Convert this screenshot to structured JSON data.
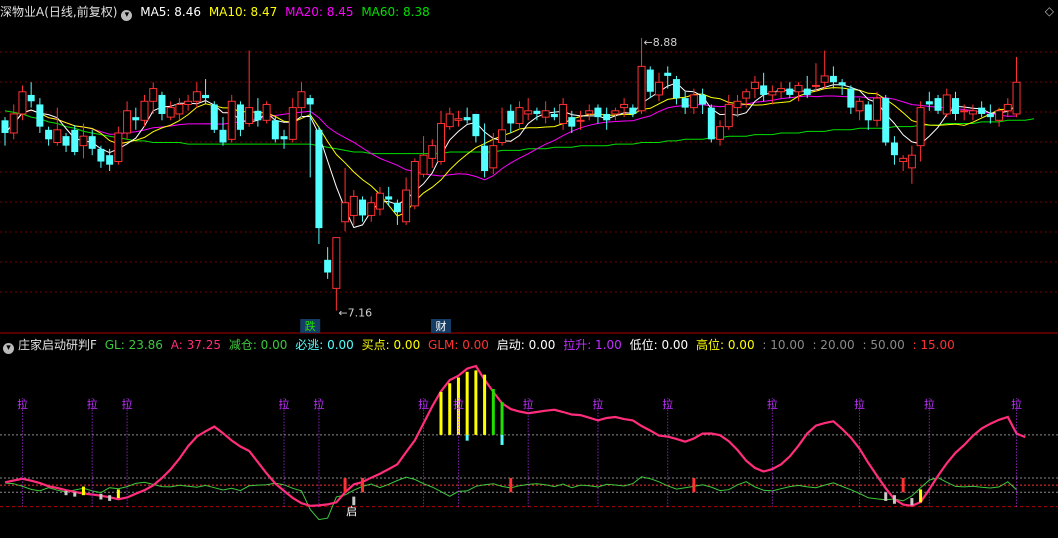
{
  "header": {
    "title": "深物业A(日线,前复权)",
    "ma5": "MA5: 8.46",
    "ma10": "MA10: 8.47",
    "ma20": "MA20: 8.45",
    "ma60": "MA60: 8.38",
    "corner": "◇"
  },
  "indicator_header": {
    "title": "庄家启动研判F",
    "gl": "GL: 23.86",
    "a": "A: 37.25",
    "jc": "减仓: 0.00",
    "bt": "必逃: 0.00",
    "md": "买点: 0.00",
    "glm": "GLM: 0.00",
    "qd": "启动: 0.00",
    "ls": "拉升: 1.00",
    "dw": "低位: 0.00",
    "gw": "高位: 0.00",
    "l10": ": 10.00",
    "l20": ": 20.00",
    "l50": ": 50.00",
    "l15": ": 15.00"
  },
  "colors": {
    "up": "#ff3232",
    "down": "#54ffff",
    "ma5": "#ffffff",
    "ma10": "#ffff00",
    "ma20": "#ff00ff",
    "ma60": "#00e000",
    "pink": "#ff2d7a",
    "green": "#3ec83e",
    "purple": "#c030ff",
    "grid": "#7a0000"
  },
  "chart_data": [
    {
      "type": "candlestick",
      "ylim": [
        7.05,
        8.98
      ],
      "high_label": "8.88",
      "low_label": "7.16",
      "markers": [
        {
          "index": 35,
          "text": "跌"
        },
        {
          "index": 50,
          "text": "财"
        }
      ],
      "ohlc": [
        [
          8.36,
          8.38,
          8.2,
          8.28
        ],
        [
          8.28,
          8.46,
          8.24,
          8.4
        ],
        [
          8.4,
          8.58,
          8.36,
          8.54
        ],
        [
          8.52,
          8.6,
          8.44,
          8.48
        ],
        [
          8.46,
          8.5,
          8.28,
          8.32
        ],
        [
          8.3,
          8.32,
          8.2,
          8.24
        ],
        [
          8.22,
          8.44,
          8.2,
          8.3
        ],
        [
          8.26,
          8.28,
          8.16,
          8.2
        ],
        [
          8.3,
          8.33,
          8.14,
          8.16
        ],
        [
          8.2,
          8.34,
          8.12,
          8.26
        ],
        [
          8.26,
          8.3,
          8.14,
          8.18
        ],
        [
          8.18,
          8.2,
          8.06,
          8.1
        ],
        [
          8.14,
          8.18,
          8.04,
          8.08
        ],
        [
          8.1,
          8.32,
          8.08,
          8.28
        ],
        [
          8.28,
          8.48,
          8.24,
          8.42
        ],
        [
          8.38,
          8.44,
          8.3,
          8.36
        ],
        [
          8.36,
          8.52,
          8.32,
          8.48
        ],
        [
          8.48,
          8.6,
          8.4,
          8.56
        ],
        [
          8.52,
          8.54,
          8.36,
          8.4
        ],
        [
          8.38,
          8.48,
          8.36,
          8.44
        ],
        [
          8.4,
          8.5,
          8.36,
          8.46
        ],
        [
          8.46,
          8.52,
          8.42,
          8.48
        ],
        [
          8.48,
          8.6,
          8.44,
          8.54
        ],
        [
          8.52,
          8.62,
          8.46,
          8.5
        ],
        [
          8.46,
          8.48,
          8.28,
          8.3
        ],
        [
          8.3,
          8.38,
          8.2,
          8.22
        ],
        [
          8.24,
          8.52,
          8.22,
          8.48
        ],
        [
          8.46,
          8.48,
          8.26,
          8.3
        ],
        [
          8.34,
          8.8,
          8.32,
          8.44
        ],
        [
          8.42,
          8.5,
          8.32,
          8.36
        ],
        [
          8.36,
          8.48,
          8.34,
          8.46
        ],
        [
          8.36,
          8.38,
          8.22,
          8.24
        ],
        [
          8.26,
          8.3,
          8.18,
          8.24
        ],
        [
          8.24,
          8.5,
          8.22,
          8.44
        ],
        [
          8.44,
          8.6,
          8.38,
          8.54
        ],
        [
          8.5,
          8.52,
          8.0,
          8.46
        ],
        [
          8.3,
          8.32,
          7.58,
          7.68
        ],
        [
          7.48,
          7.56,
          7.36,
          7.4
        ],
        [
          7.3,
          7.46,
          7.16,
          7.62
        ],
        [
          7.72,
          8.06,
          7.66,
          7.84
        ],
        [
          7.76,
          7.92,
          7.7,
          7.88
        ],
        [
          7.86,
          7.88,
          7.72,
          7.76
        ],
        [
          7.76,
          7.88,
          7.72,
          7.84
        ],
        [
          7.8,
          7.94,
          7.76,
          7.9
        ],
        [
          7.88,
          7.94,
          7.82,
          7.86
        ],
        [
          7.84,
          7.86,
          7.7,
          7.78
        ],
        [
          7.72,
          8.0,
          7.7,
          7.92
        ],
        [
          7.82,
          8.12,
          7.8,
          8.1
        ],
        [
          8.02,
          8.26,
          8.0,
          8.14
        ],
        [
          8.12,
          8.24,
          8.06,
          8.2
        ],
        [
          8.1,
          8.42,
          8.08,
          8.34
        ],
        [
          8.32,
          8.44,
          8.3,
          8.4
        ],
        [
          8.36,
          8.42,
          8.32,
          8.37
        ],
        [
          8.38,
          8.44,
          8.34,
          8.36
        ],
        [
          8.4,
          8.4,
          8.22,
          8.26
        ],
        [
          8.2,
          8.34,
          8.0,
          8.04
        ],
        [
          8.06,
          8.28,
          8.02,
          8.2
        ],
        [
          8.22,
          8.44,
          8.2,
          8.3
        ],
        [
          8.42,
          8.46,
          8.28,
          8.34
        ],
        [
          8.34,
          8.48,
          8.3,
          8.44
        ],
        [
          8.4,
          8.5,
          8.36,
          8.42
        ],
        [
          8.42,
          8.44,
          8.36,
          8.4
        ],
        [
          8.38,
          8.48,
          8.34,
          8.42
        ],
        [
          8.4,
          8.44,
          8.36,
          8.38
        ],
        [
          8.34,
          8.5,
          8.3,
          8.46
        ],
        [
          8.38,
          8.42,
          8.28,
          8.32
        ],
        [
          8.36,
          8.42,
          8.3,
          8.36
        ],
        [
          8.4,
          8.46,
          8.36,
          8.42
        ],
        [
          8.44,
          8.46,
          8.34,
          8.38
        ],
        [
          8.4,
          8.44,
          8.3,
          8.36
        ],
        [
          8.4,
          8.44,
          8.36,
          8.42
        ],
        [
          8.44,
          8.5,
          8.38,
          8.46
        ],
        [
          8.44,
          8.46,
          8.38,
          8.4
        ],
        [
          8.42,
          8.88,
          8.4,
          8.7
        ],
        [
          8.68,
          8.7,
          8.5,
          8.54
        ],
        [
          8.52,
          8.66,
          8.48,
          8.6
        ],
        [
          8.66,
          8.7,
          8.56,
          8.64
        ],
        [
          8.62,
          8.64,
          8.46,
          8.5
        ],
        [
          8.5,
          8.54,
          8.4,
          8.44
        ],
        [
          8.44,
          8.56,
          8.4,
          8.52
        ],
        [
          8.52,
          8.56,
          8.4,
          8.46
        ],
        [
          8.44,
          8.46,
          8.22,
          8.24
        ],
        [
          8.24,
          8.36,
          8.2,
          8.32
        ],
        [
          8.32,
          8.52,
          8.3,
          8.46
        ],
        [
          8.44,
          8.52,
          8.38,
          8.48
        ],
        [
          8.5,
          8.56,
          8.44,
          8.54
        ],
        [
          8.56,
          8.64,
          8.5,
          8.6
        ],
        [
          8.58,
          8.66,
          8.48,
          8.52
        ],
        [
          8.52,
          8.58,
          8.46,
          8.54
        ],
        [
          8.54,
          8.6,
          8.5,
          8.56
        ],
        [
          8.56,
          8.6,
          8.5,
          8.52
        ],
        [
          8.54,
          8.6,
          8.48,
          8.58
        ],
        [
          8.56,
          8.64,
          8.5,
          8.52
        ],
        [
          8.58,
          8.72,
          8.54,
          8.58
        ],
        [
          8.6,
          8.8,
          8.56,
          8.64
        ],
        [
          8.64,
          8.7,
          8.56,
          8.6
        ],
        [
          8.6,
          8.62,
          8.52,
          8.58
        ],
        [
          8.56,
          8.58,
          8.4,
          8.44
        ],
        [
          8.42,
          8.5,
          8.36,
          8.48
        ],
        [
          8.46,
          8.48,
          8.3,
          8.36
        ],
        [
          8.36,
          8.54,
          8.32,
          8.5
        ],
        [
          8.5,
          8.52,
          8.2,
          8.22
        ],
        [
          8.22,
          8.26,
          8.08,
          8.14
        ],
        [
          8.1,
          8.14,
          8.04,
          8.12
        ],
        [
          8.06,
          8.2,
          7.96,
          8.14
        ],
        [
          8.2,
          8.48,
          8.1,
          8.44
        ],
        [
          8.48,
          8.54,
          8.42,
          8.46
        ],
        [
          8.5,
          8.52,
          8.4,
          8.42
        ],
        [
          8.4,
          8.56,
          8.38,
          8.52
        ],
        [
          8.5,
          8.54,
          8.36,
          8.4
        ],
        [
          8.42,
          8.46,
          8.36,
          8.42
        ],
        [
          8.4,
          8.46,
          8.36,
          8.42
        ],
        [
          8.44,
          8.48,
          8.38,
          8.4
        ],
        [
          8.4,
          8.46,
          8.34,
          8.38
        ],
        [
          8.36,
          8.44,
          8.32,
          8.42
        ],
        [
          8.42,
          8.5,
          8.38,
          8.46
        ],
        [
          8.4,
          8.76,
          8.38,
          8.6
        ]
      ],
      "ma60": [
        8.42,
        8.41,
        8.4,
        8.38,
        8.37,
        8.35,
        8.34,
        8.32,
        8.31,
        8.29,
        8.28,
        8.27,
        8.26,
        8.25,
        8.24,
        8.23,
        8.23,
        8.22,
        8.22,
        8.22,
        8.22,
        8.21,
        8.21,
        8.21,
        8.21,
        8.21,
        8.21,
        8.21,
        8.21,
        8.21,
        8.21,
        8.21,
        8.21,
        8.21,
        8.21,
        8.21,
        8.2,
        8.19,
        8.18,
        8.17,
        8.16,
        8.16,
        8.15,
        8.15,
        8.15,
        8.15,
        8.15,
        8.15,
        8.15,
        8.15,
        8.15,
        8.16,
        8.16,
        8.16,
        8.16,
        8.16,
        8.16,
        8.17,
        8.17,
        8.17,
        8.18,
        8.18,
        8.18,
        8.19,
        8.19,
        8.19,
        8.2,
        8.2,
        8.2,
        8.2,
        8.21,
        8.21,
        8.21,
        8.22,
        8.22,
        8.22,
        8.23,
        8.23,
        8.24,
        8.24,
        8.24,
        8.25,
        8.25,
        8.26,
        8.26,
        8.26,
        8.27,
        8.27,
        8.27,
        8.28,
        8.28,
        8.28,
        8.29,
        8.29,
        8.29,
        8.3,
        8.3,
        8.3,
        8.31,
        8.31,
        8.31,
        8.31,
        8.32,
        8.32,
        8.32,
        8.33,
        8.33,
        8.33,
        8.34,
        8.34,
        8.34,
        8.34,
        8.35,
        8.35,
        8.35,
        8.36,
        8.36,
        8.36,
        8.37
      ]
    },
    {
      "type": "line",
      "title": "庄家启动研判F",
      "ylim": [
        -10,
        105
      ],
      "ref_lines": [
        10,
        20,
        50,
        15
      ],
      "la_marks": [
        2,
        10,
        14,
        32,
        36,
        48,
        52,
        60,
        68,
        76,
        88,
        98,
        106,
        116
      ],
      "la_text": "拉",
      "qi_mark": {
        "index": 39,
        "text": "启"
      },
      "pink_series": [
        17.0,
        18.2,
        19.4,
        18.1,
        16.5,
        14.2,
        13.0,
        11.5,
        10.3,
        9.2,
        8.5,
        7.6,
        6.5,
        5.2,
        6.4,
        9.0,
        11.5,
        14.8,
        20.0,
        26.0,
        33.5,
        42.1,
        48.8,
        52.5,
        55.8,
        51.2,
        46.1,
        41.9,
        38.8,
        31.0,
        23.2,
        16.1,
        11.0,
        6.0,
        2.4,
        0.6,
        0.9,
        1.6,
        3.0,
        10.0,
        15.5,
        17.2,
        20.2,
        23.0,
        26.2,
        29.5,
        38.0,
        46.2,
        58.1,
        70.0,
        80.5,
        88.2,
        91.3,
        96.2,
        98.0,
        88.5,
        80.0,
        72.0,
        68.0,
        66.3,
        65.1,
        66.0,
        66.9,
        67.5,
        66.0,
        64.2,
        63.8,
        62.0,
        60.1,
        61.8,
        62.5,
        61.0,
        60.1,
        56.2,
        53.0,
        49.5,
        48.8,
        47.2,
        45.3,
        47.5,
        50.9,
        51.0,
        49.8,
        45.6,
        39.5,
        32.0,
        27.0,
        24.5,
        26.2,
        29.5,
        35.0,
        42.5,
        51.0,
        56.5,
        58.2,
        59.5,
        54.2,
        48.1,
        40.3,
        30.5,
        21.5,
        12.8,
        5.2,
        1.4,
        0.6,
        3.2,
        12.0,
        21.5,
        30.2,
        37.5,
        43.0,
        49.4,
        54.5,
        57.8,
        60.5,
        62.5,
        51.0,
        48.5
      ],
      "green_series": [
        16.5,
        16.0,
        14.2,
        12.0,
        11.0,
        13.2,
        11.5,
        10.2,
        11.6,
        12.8,
        11.0,
        9.8,
        13.2,
        12.5,
        14.0,
        16.2,
        17.0,
        15.5,
        14.0,
        13.8,
        14.9,
        14.2,
        13.5,
        14.8,
        13.2,
        11.6,
        12.8,
        11.2,
        14.5,
        15.0,
        15.2,
        16.4,
        15.2,
        12.8,
        11.0,
        -2.0,
        -9.0,
        -8.0,
        6.8,
        8.2,
        11.5,
        14.1,
        15.8,
        13.3,
        15.6,
        18.2,
        20.6,
        19.0,
        16.0,
        13.6,
        10.5,
        7.2,
        10.6,
        11.0,
        14.2,
        15.2,
        16.0,
        14.1,
        13.1,
        14.6,
        15.5,
        16.0,
        15.2,
        14.0,
        15.8,
        13.2,
        15.0,
        14.6,
        13.7,
        15.6,
        15.1,
        14.4,
        16.1,
        20.8,
        19.5,
        17.3,
        14.5,
        12.2,
        13.2,
        14.1,
        15.2,
        13.6,
        11.2,
        11.8,
        15.2,
        17.4,
        13.8,
        11.5,
        11.0,
        12.5,
        14.0,
        14.8,
        13.8,
        13.2,
        15.0,
        16.6,
        14.1,
        11.8,
        9.2,
        6.2,
        5.4,
        4.8,
        5.3,
        4.0,
        7.5,
        13.2,
        18.5,
        20.2,
        17.0,
        14.1,
        13.8,
        14.2,
        13.5,
        13.0,
        13.8,
        17.4,
        11.8
      ],
      "red_bars": [
        {
          "index": 39,
          "top": 20,
          "bottom": 10
        },
        {
          "index": 41,
          "top": 20,
          "bottom": 10
        },
        {
          "index": 58,
          "top": 20,
          "bottom": 10
        },
        {
          "index": 79,
          "top": 20,
          "bottom": 10
        },
        {
          "index": 103,
          "top": 20,
          "bottom": 10
        }
      ],
      "white_bars": [
        {
          "index": 7,
          "top": 11,
          "bottom": 8
        },
        {
          "index": 8,
          "top": 10,
          "bottom": 7
        },
        {
          "index": 11,
          "top": 9,
          "bottom": 5
        },
        {
          "index": 12,
          "top": 8,
          "bottom": 4
        },
        {
          "index": 40,
          "top": 7,
          "bottom": 1
        },
        {
          "index": 101,
          "top": 10,
          "bottom": 4
        },
        {
          "index": 102,
          "top": 8,
          "bottom": 2
        },
        {
          "index": 104,
          "top": 6,
          "bottom": 1
        }
      ],
      "yellow_bars": [
        {
          "index": 9,
          "top": 14,
          "bottom": 8
        },
        {
          "index": 13,
          "top": 12,
          "bottom": 6
        },
        {
          "index": 105,
          "top": 12,
          "bottom": 3
        }
      ],
      "top_bars": [
        {
          "index": 50,
          "top": 80,
          "bottom": 50,
          "color": "#ffff00"
        },
        {
          "index": 51,
          "top": 86,
          "bottom": 50,
          "color": "#ffff00"
        },
        {
          "index": 52,
          "top": 90,
          "bottom": 50,
          "color": "#ffff00"
        },
        {
          "index": 53,
          "top": 94,
          "bottom": 50,
          "color": "#ffff00"
        },
        {
          "index": 54,
          "top": 95,
          "bottom": 50,
          "color": "#ffff00"
        },
        {
          "index": 55,
          "top": 92,
          "bottom": 50,
          "color": "#ffff00"
        },
        {
          "index": 56,
          "top": 82,
          "bottom": 50,
          "color": "#22e000"
        },
        {
          "index": 57,
          "top": 73,
          "bottom": 50,
          "color": "#22e000"
        }
      ]
    }
  ]
}
